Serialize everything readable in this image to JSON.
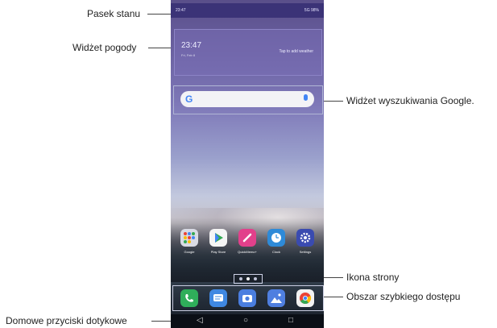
{
  "callouts": {
    "status_bar": "Pasek stanu",
    "weather_widget": "Widżet pogody",
    "google_search_widget": "Widżet wyszukiwania Google.",
    "page_icon": "Ikona strony",
    "quick_access": "Obszar szybkiego dostępu",
    "home_touch_buttons": "Domowe przyciski dotykowe"
  },
  "phone": {
    "status_bar": {
      "time": "23:47",
      "right": "5G 98%"
    },
    "weather": {
      "time": "23:47",
      "date": "Fri, Feb 8",
      "hint": "Tap to add weather"
    },
    "search": {
      "logo": "G"
    },
    "apps": [
      {
        "label": "Google",
        "icon": "google-folder-icon",
        "color": "#d9dbe4"
      },
      {
        "label": "Play Store",
        "icon": "play-store-icon",
        "color": "#f5f5f5"
      },
      {
        "label": "QuickMemo+",
        "icon": "quickmemo-icon",
        "color": "#e2408b"
      },
      {
        "label": "Clock",
        "icon": "clock-icon",
        "color": "#2e8ad8"
      },
      {
        "label": "Settings",
        "icon": "settings-gear-icon",
        "color": "#3a4bb0"
      }
    ],
    "dock": [
      {
        "icon": "phone-icon",
        "color": "#2fae5a"
      },
      {
        "icon": "messages-icon",
        "color": "#3f88e2"
      },
      {
        "icon": "camera-icon",
        "color": "#4a7ee0"
      },
      {
        "icon": "gallery-icon",
        "color": "#4f7fe0"
      },
      {
        "icon": "chrome-icon",
        "color": "#f2f2f2"
      }
    ],
    "navbar": {
      "back": "◁",
      "home": "○",
      "recent": "□"
    }
  }
}
